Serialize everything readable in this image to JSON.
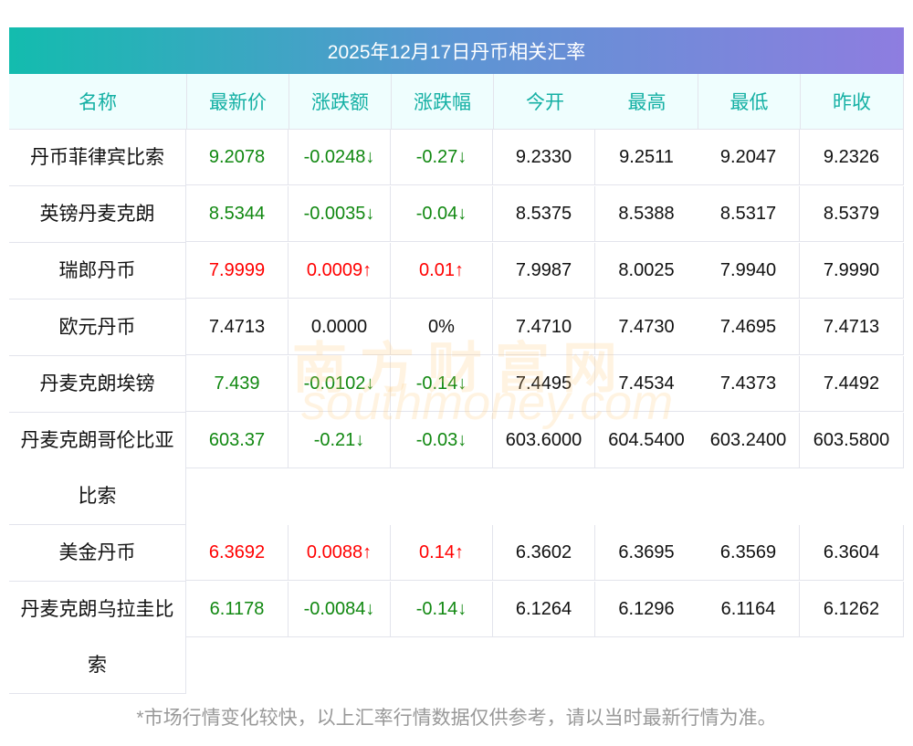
{
  "title": "2025年12月17日丹币相关汇率",
  "headers": [
    "名称",
    "最新价",
    "涨跌额",
    "涨跌幅",
    "今开",
    "最高",
    "最低",
    "昨收"
  ],
  "rows": [
    {
      "name": [
        "丹币菲律宾比索"
      ],
      "latest": "9.2078",
      "change": "-0.0248↓",
      "pct": "-0.27↓",
      "open": "9.2330",
      "high": "9.2511",
      "low": "9.2047",
      "prev": "9.2326",
      "dir": "down"
    },
    {
      "name": [
        "英镑丹麦克朗"
      ],
      "latest": "8.5344",
      "change": "-0.0035↓",
      "pct": "-0.04↓",
      "open": "8.5375",
      "high": "8.5388",
      "low": "8.5317",
      "prev": "8.5379",
      "dir": "down"
    },
    {
      "name": [
        "瑞郎丹币"
      ],
      "latest": "7.9999",
      "change": "0.0009↑",
      "pct": "0.01↑",
      "open": "7.9987",
      "high": "8.0025",
      "low": "7.9940",
      "prev": "7.9990",
      "dir": "up"
    },
    {
      "name": [
        "欧元丹币"
      ],
      "latest": "7.4713",
      "change": "0.0000",
      "pct": "0%",
      "open": "7.4710",
      "high": "7.4730",
      "low": "7.4695",
      "prev": "7.4713",
      "dir": "flat"
    },
    {
      "name": [
        "丹麦克朗埃镑"
      ],
      "latest": "7.439",
      "change": "-0.0102↓",
      "pct": "-0.14↓",
      "open": "7.4495",
      "high": "7.4534",
      "low": "7.4373",
      "prev": "7.4492",
      "dir": "down"
    },
    {
      "name": [
        "丹麦克朗哥伦比亚",
        "比索"
      ],
      "latest": "603.37",
      "change": "-0.21↓",
      "pct": "-0.03↓",
      "open": "603.6000",
      "high": "604.5400",
      "low": "603.2400",
      "prev": "603.5800",
      "dir": "down"
    },
    {
      "name": [
        "美金丹币"
      ],
      "latest": "6.3692",
      "change": "0.0088↑",
      "pct": "0.14↑",
      "open": "6.3602",
      "high": "6.3695",
      "low": "6.3569",
      "prev": "6.3604",
      "dir": "up"
    },
    {
      "name": [
        "丹麦克朗乌拉圭比",
        "索"
      ],
      "latest": "6.1178",
      "change": "-0.0084↓",
      "pct": "-0.14↓",
      "open": "6.1264",
      "high": "6.1296",
      "low": "6.1164",
      "prev": "6.1262",
      "dir": "down"
    }
  ],
  "watermark": {
    "cn": "南方财富网",
    "en": "southmoney.com"
  },
  "footer": "*市场行情变化较快，以上汇率行情数据仅供参考，请以当时最新行情为准。",
  "colors": {
    "up": "#ff0000",
    "down": "#118811",
    "header_text": "#14b0a4"
  }
}
